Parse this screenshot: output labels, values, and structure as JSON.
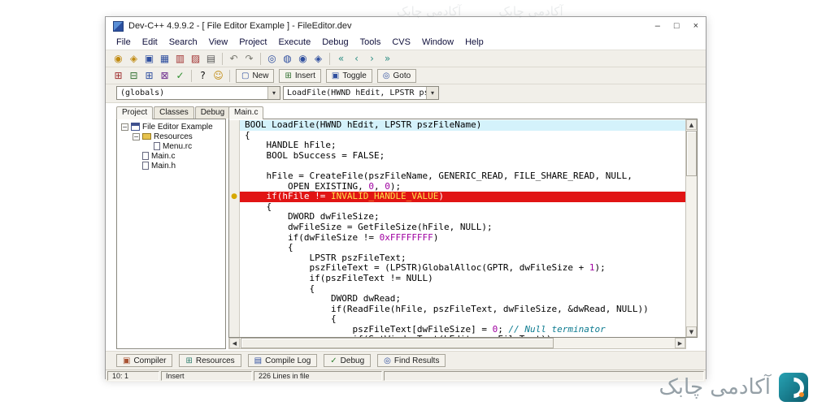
{
  "window": {
    "title": "Dev-C++ 4.9.9.2  -  [ File Editor Example ] - FileEditor.dev",
    "controls": {
      "minimize": "–",
      "maximize": "□",
      "close": "×"
    }
  },
  "glyphs": {
    "dropdown": "▾",
    "up": "▲",
    "down": "▼",
    "left": "◀",
    "right": "▶",
    "bullet": "●",
    "minus": "−"
  },
  "menu": {
    "items": [
      "File",
      "Edit",
      "Search",
      "View",
      "Project",
      "Execute",
      "Debug",
      "Tools",
      "CVS",
      "Window",
      "Help"
    ]
  },
  "toolbar_main": [
    {
      "t": "icon",
      "name": "new-project-icon",
      "g": "◉",
      "c": "#c08a10"
    },
    {
      "t": "icon",
      "name": "open-project-icon",
      "g": "◈",
      "c": "#c08a10"
    },
    {
      "t": "icon",
      "name": "save-icon",
      "g": "▣",
      "c": "#2f4f9f"
    },
    {
      "t": "icon",
      "name": "save-all-icon",
      "g": "▦",
      "c": "#2f4f9f"
    },
    {
      "t": "icon",
      "name": "close-file-icon",
      "g": "▥",
      "c": "#a03030"
    },
    {
      "t": "icon",
      "name": "close-all-icon",
      "g": "▨",
      "c": "#a03030"
    },
    {
      "t": "icon",
      "name": "print-icon",
      "g": "▤",
      "c": "#5a5a5a"
    },
    {
      "t": "sep"
    },
    {
      "t": "icon",
      "name": "undo-icon",
      "g": "↶",
      "c": "#7a7a72"
    },
    {
      "t": "icon",
      "name": "redo-icon",
      "g": "↷",
      "c": "#7a7a72"
    },
    {
      "t": "sep"
    },
    {
      "t": "icon",
      "name": "find-icon",
      "g": "◎",
      "c": "#2f4f9f"
    },
    {
      "t": "icon",
      "name": "replace-icon",
      "g": "◍",
      "c": "#2f4f9f"
    },
    {
      "t": "icon",
      "name": "find-in-files-icon",
      "g": "◉",
      "c": "#2f4f9f"
    },
    {
      "t": "icon",
      "name": "goto-line-icon",
      "g": "◈",
      "c": "#2f4f9f"
    },
    {
      "t": "sep"
    },
    {
      "t": "icon",
      "name": "back-icon",
      "g": "«",
      "c": "#2f8f86"
    },
    {
      "t": "icon",
      "name": "previous-icon",
      "g": "‹",
      "c": "#2f8f86"
    },
    {
      "t": "icon",
      "name": "next-icon",
      "g": "›",
      "c": "#2f8f86"
    },
    {
      "t": "icon",
      "name": "forward-icon",
      "g": "»",
      "c": "#2f8f86"
    }
  ],
  "toolbar_second": [
    {
      "t": "icon",
      "name": "compile-icon",
      "g": "⊞",
      "c": "#a03030"
    },
    {
      "t": "icon",
      "name": "run-icon",
      "g": "⊟",
      "c": "#2f6f2f"
    },
    {
      "t": "icon",
      "name": "compile-run-icon",
      "g": "⊞",
      "c": "#2f4f9f"
    },
    {
      "t": "icon",
      "name": "rebuild-all-icon",
      "g": "⊠",
      "c": "#6f2f8f"
    },
    {
      "t": "icon",
      "name": "syntax-check-icon",
      "g": "✓",
      "c": "#2f8f2f"
    },
    {
      "t": "sep"
    },
    {
      "t": "icon",
      "name": "help-icon",
      "g": "?",
      "c": "#101010"
    },
    {
      "t": "icon",
      "name": "about-icon",
      "g": "☺",
      "c": "#c08a10"
    },
    {
      "t": "sep"
    },
    {
      "t": "button",
      "name": "new-button",
      "label": "New",
      "g": "▢",
      "c": "#2f4f9f"
    },
    {
      "t": "button",
      "name": "insert-button",
      "label": "Insert",
      "g": "⊞",
      "c": "#2f6f2f"
    },
    {
      "t": "button",
      "name": "toggle-button",
      "label": "Toggle",
      "g": "▣",
      "c": "#2f4f9f"
    },
    {
      "t": "button",
      "name": "goto-button",
      "label": "Goto",
      "g": "◎",
      "c": "#2f4f9f"
    }
  ],
  "combos": {
    "globals": "(globals)",
    "members": "LoadFile(HWND hEdit, LPSTR psz"
  },
  "left_panel": {
    "tabs": [
      {
        "label": "Project",
        "active": true
      },
      {
        "label": "Classes",
        "active": false
      },
      {
        "label": "Debug",
        "active": false
      }
    ],
    "tree": [
      {
        "label": "File Editor Example",
        "level": 0,
        "expander": true,
        "icon": "project"
      },
      {
        "label": "Resources",
        "level": 1,
        "expander": true,
        "icon": "folder"
      },
      {
        "label": "Menu.rc",
        "level": 2,
        "expander": false,
        "icon": "file"
      },
      {
        "label": "Main.c",
        "level": 1,
        "expander": false,
        "icon": "file"
      },
      {
        "label": "Main.h",
        "level": 1,
        "expander": false,
        "icon": "file"
      }
    ]
  },
  "editor": {
    "tab": "Main.c",
    "lines": [
      {
        "bg": "active",
        "segs": [
          [
            "p",
            "BOOL LoadFile(HWND hEdit, LPSTR pszFileName)"
          ]
        ]
      },
      {
        "segs": [
          [
            "p",
            "{"
          ]
        ]
      },
      {
        "segs": [
          [
            "p",
            "    HANDLE hFile;"
          ]
        ]
      },
      {
        "segs": [
          [
            "p",
            "    BOOL bSuccess = FALSE;"
          ]
        ]
      },
      {
        "segs": []
      },
      {
        "segs": [
          [
            "p",
            "    hFile = CreateFile(pszFileName, GENERIC_READ, FILE_SHARE_READ, NULL,"
          ]
        ]
      },
      {
        "segs": [
          [
            "p",
            "        OPEN_EXISTING, "
          ],
          [
            "n",
            "0"
          ],
          [
            "p",
            ", "
          ],
          [
            "n",
            "0"
          ],
          [
            "p",
            ");"
          ]
        ]
      },
      {
        "bg": "break",
        "marker": true,
        "segs": [
          [
            "w",
            "    if(hFile != "
          ],
          [
            "y",
            "INVALID_HANDLE_VALUE"
          ],
          [
            "w",
            ")"
          ]
        ]
      },
      {
        "segs": [
          [
            "p",
            "    {"
          ]
        ]
      },
      {
        "segs": [
          [
            "p",
            "        DWORD dwFileSize;"
          ]
        ]
      },
      {
        "segs": [
          [
            "p",
            "        dwFileSize = GetFileSize(hFile, NULL);"
          ]
        ]
      },
      {
        "segs": [
          [
            "p",
            "        if(dwFileSize != "
          ],
          [
            "n",
            "0xFFFFFFFF"
          ],
          [
            "p",
            ")"
          ]
        ]
      },
      {
        "segs": [
          [
            "p",
            "        {"
          ]
        ]
      },
      {
        "segs": [
          [
            "p",
            "            LPSTR pszFileText;"
          ]
        ]
      },
      {
        "segs": [
          [
            "p",
            "            pszFileText = (LPSTR)GlobalAlloc(GPTR, dwFileSize + "
          ],
          [
            "n",
            "1"
          ],
          [
            "p",
            ");"
          ]
        ]
      },
      {
        "segs": [
          [
            "p",
            "            if(pszFileText != NULL)"
          ]
        ]
      },
      {
        "segs": [
          [
            "p",
            "            {"
          ]
        ]
      },
      {
        "segs": [
          [
            "p",
            "                DWORD dwRead;"
          ]
        ]
      },
      {
        "segs": [
          [
            "p",
            "                if(ReadFile(hFile, pszFileText, dwFileSize, &dwRead, NULL))"
          ]
        ]
      },
      {
        "segs": [
          [
            "p",
            "                {"
          ]
        ]
      },
      {
        "segs": [
          [
            "p",
            "                    pszFileText[dwFileSize] = "
          ],
          [
            "n",
            "0"
          ],
          [
            "p",
            "; "
          ],
          [
            "c",
            "// Null terminator"
          ]
        ]
      },
      {
        "segs": [
          [
            "p",
            "                    if(SetWindowText(hEdit, pszFileText))"
          ]
        ]
      }
    ]
  },
  "bottom_tabs": [
    {
      "label": "Compiler",
      "g": "▣",
      "c": "#a85232"
    },
    {
      "label": "Resources",
      "g": "⊞",
      "c": "#2f7f6f"
    },
    {
      "label": "Compile Log",
      "g": "▤",
      "c": "#2f4f9f"
    },
    {
      "label": "Debug",
      "g": "✓",
      "c": "#2f7f2f"
    },
    {
      "label": "Find Results",
      "g": "◎",
      "c": "#2f4f9f"
    }
  ],
  "status": {
    "cells": [
      "10: 1",
      "Insert",
      "226 Lines in file"
    ]
  },
  "watermark": {
    "text": "آکادمی چابک",
    "accent": "#1f8a99"
  }
}
